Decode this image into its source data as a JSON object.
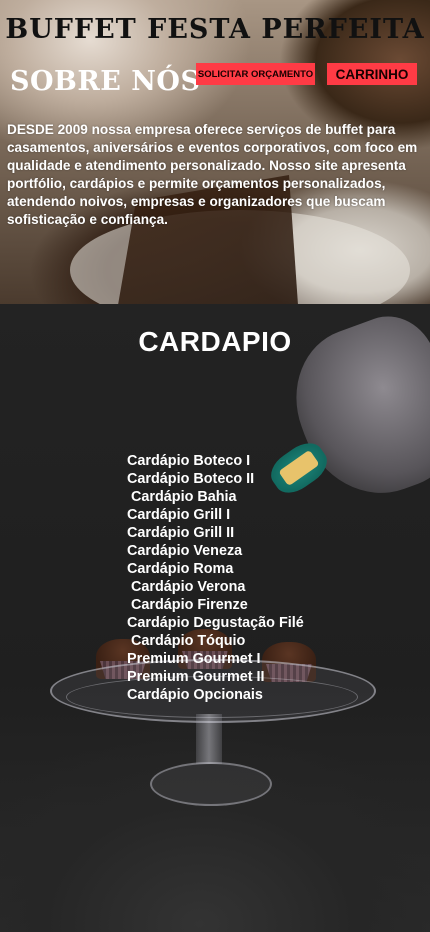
{
  "header": {
    "site_title": "BUFFET FESTA PERFEITA",
    "section_title": "SOBRE NÓS",
    "quote_button": "SOLICITAR ORÇAMENTO",
    "cart_button": "CARRINHO"
  },
  "about": {
    "text": "DESDE 2009 nossa empresa oferece serviços de buffet para casamentos, aniversários e eventos corporativos, com foco em qualidade e atendimento personalizado. Nosso site apresenta portfólio, cardápios e permite orçamentos personalizados, atendendo noivos, empresas e organizadores que buscam sofisticação e confiança."
  },
  "menu": {
    "title": "CARDAPIO",
    "items": [
      "Cardápio Boteco I",
      "Cardápio Boteco II",
      " Cardápio Bahia",
      "Cardápio Grill I",
      "Cardápio Grill II",
      "Cardápio Veneza",
      "Cardápio Roma",
      " Cardápio Verona",
      " Cardápio Firenze",
      "Cardápio Degustação Filé",
      " Cardápio Tóquio",
      "Premium Gourmet I",
      "Premium Gourmet II",
      "Cardápio Opcionais"
    ]
  },
  "colors": {
    "button_bg": "#ff3b45",
    "text_light": "#ffffff",
    "text_dark": "#111111"
  }
}
